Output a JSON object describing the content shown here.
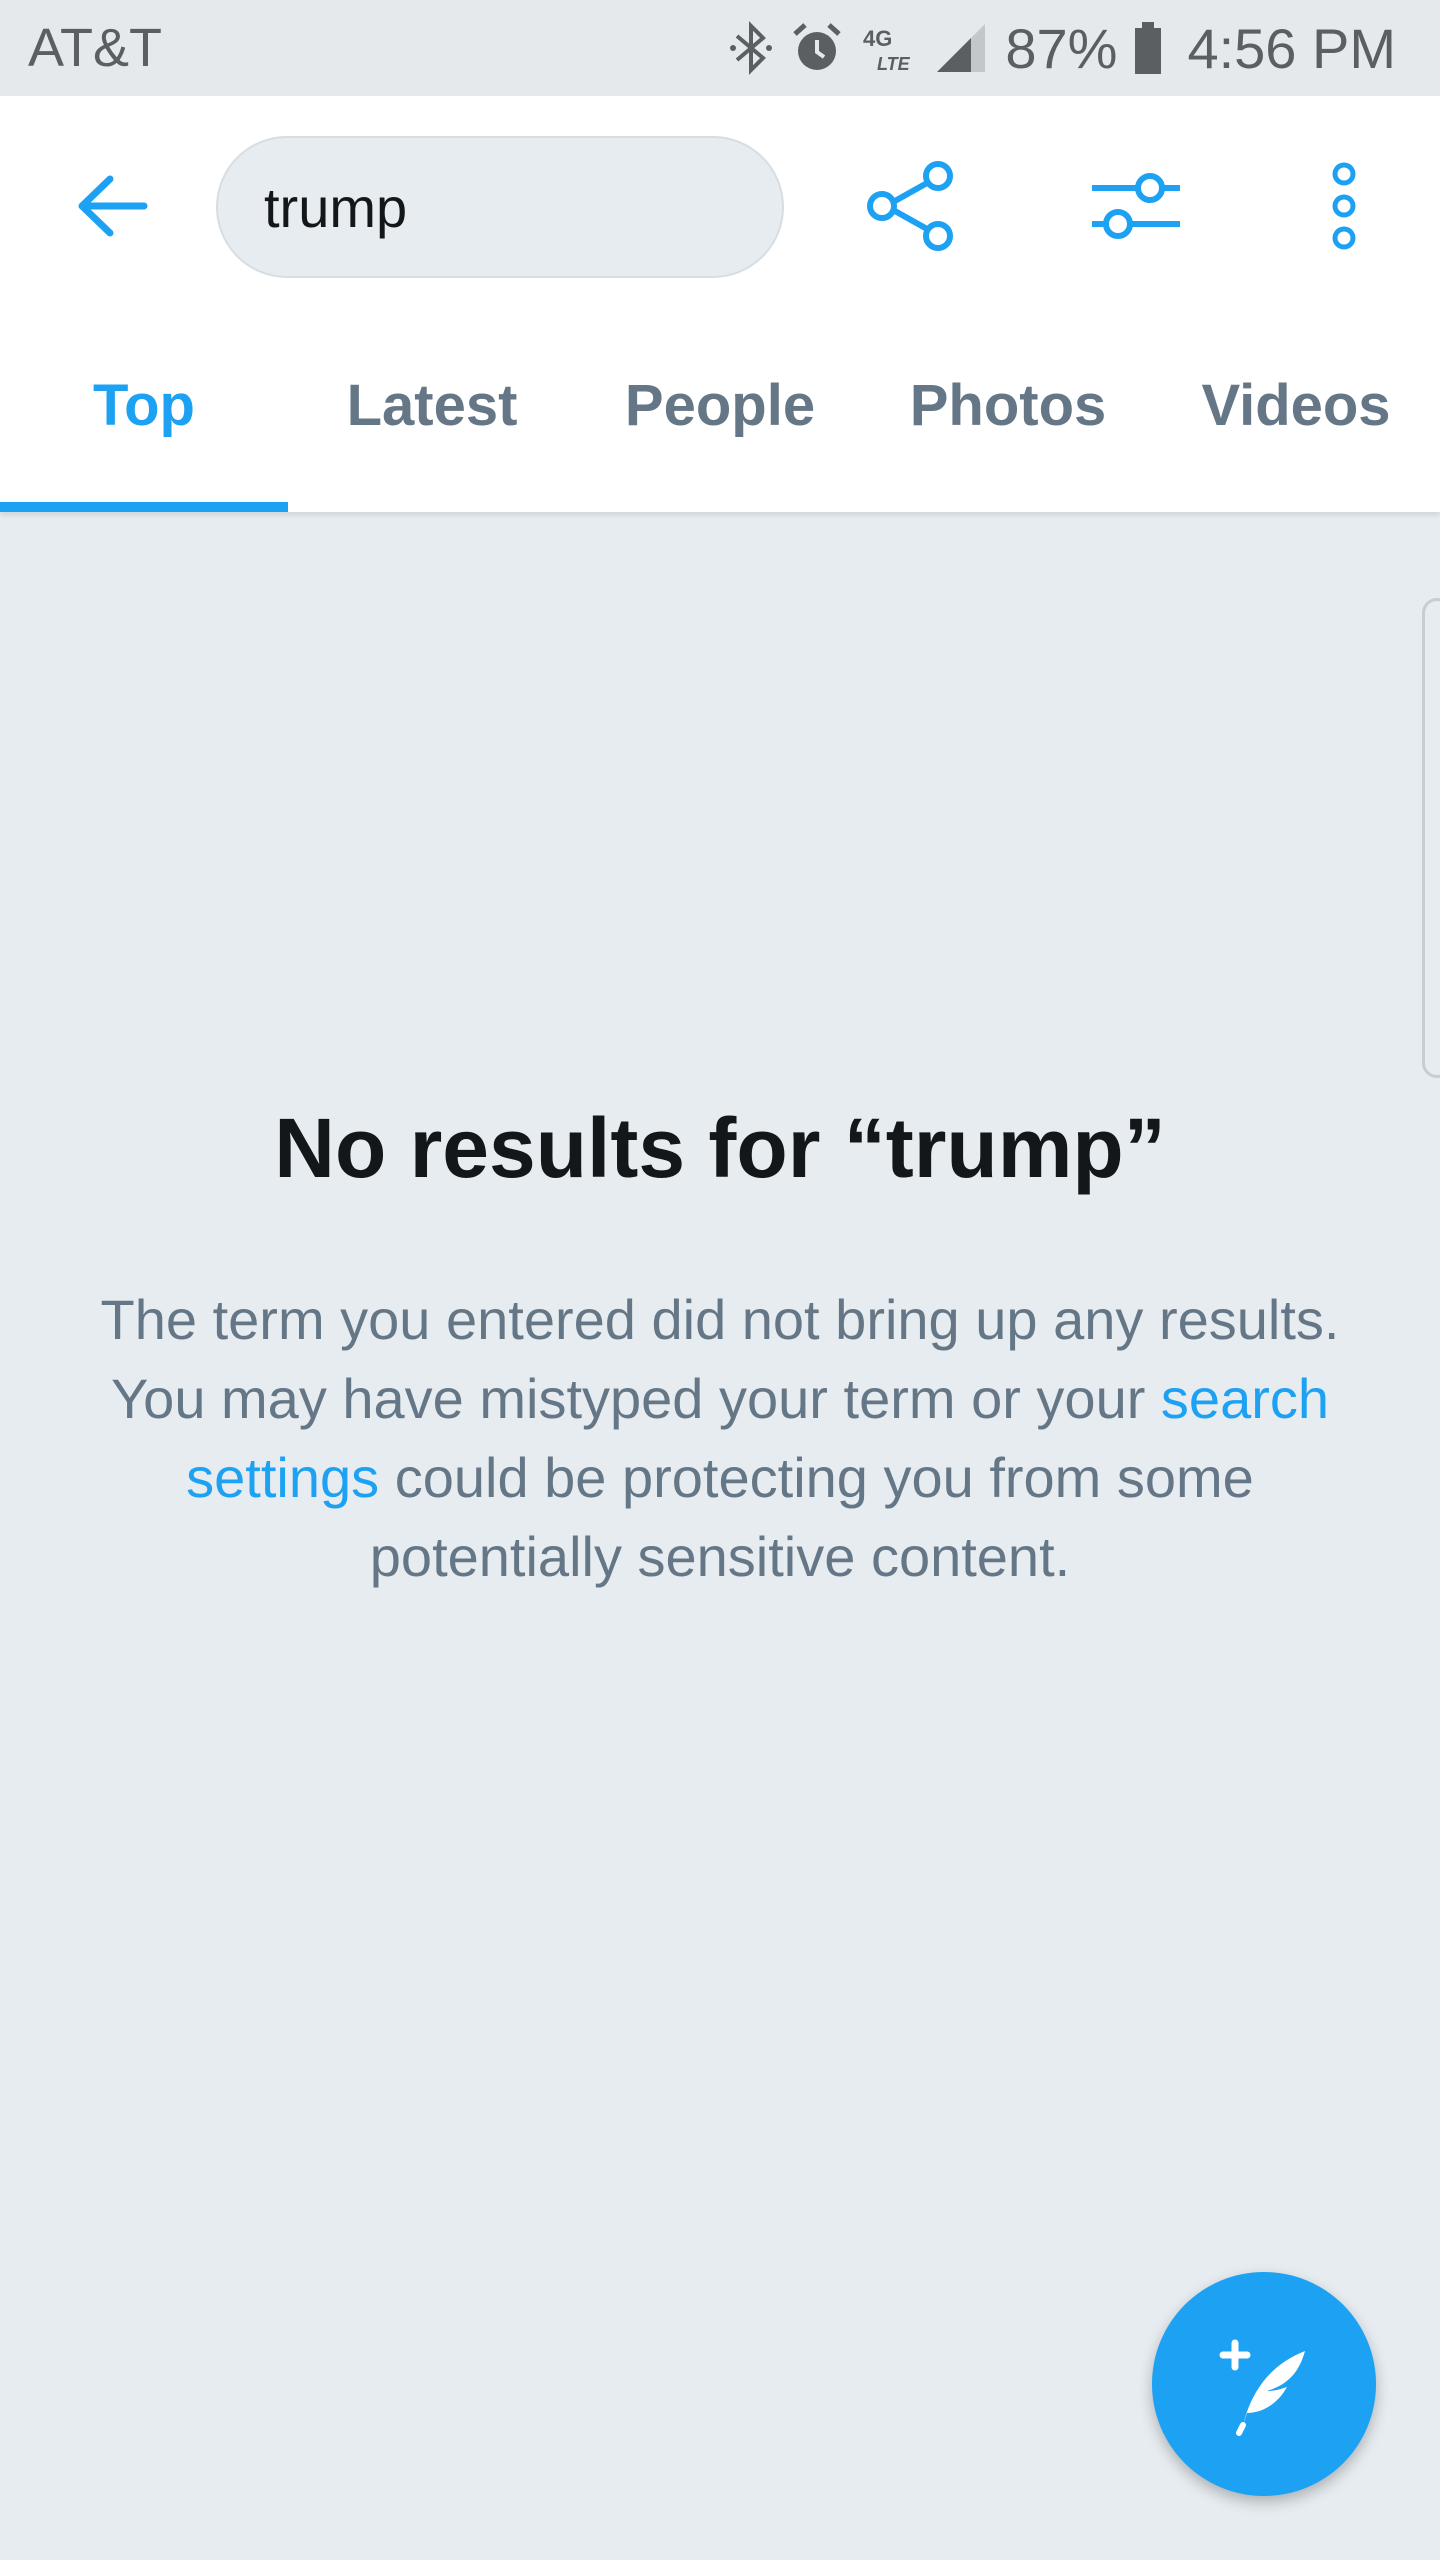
{
  "status_bar": {
    "carrier": "AT&T",
    "network_label": "4G LTE",
    "battery": "87%",
    "time": "4:56 PM"
  },
  "search": {
    "query": "trump"
  },
  "tabs": [
    {
      "label": "Top",
      "active": true
    },
    {
      "label": "Latest",
      "active": false
    },
    {
      "label": "People",
      "active": false
    },
    {
      "label": "Photos",
      "active": false
    },
    {
      "label": "Videos",
      "active": false
    }
  ],
  "empty_state": {
    "title": "No results for “trump”",
    "body_part1": "The term you entered did not bring up any results. You may have mistyped your term or your ",
    "link_text": "search settings",
    "body_part2": " could be protecting you from some potentially sensitive content."
  },
  "icons": {
    "back": "arrow-left-icon",
    "share": "share-icon",
    "filter": "sliders-icon",
    "more": "more-vertical-icon",
    "compose": "compose-tweet-icon"
  },
  "colors": {
    "accent": "#1da1f2",
    "background": "#e6ecf0",
    "text_primary": "#14171a",
    "text_secondary": "#657786"
  }
}
